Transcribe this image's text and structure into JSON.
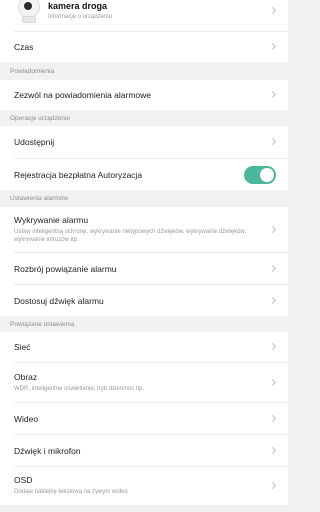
{
  "device": {
    "name": "kamera droga",
    "subtitle": "Informacje o urządzeniu"
  },
  "time_row": {
    "label": "Czas"
  },
  "notifications": {
    "header": "Powiadomienia",
    "allow_alarm_notifications": "Zezwól na powiadomienia alarmowe"
  },
  "device_operations": {
    "header": "Operacje urządzenie",
    "share": "Udostępnij",
    "free_registration": "Rejestracja bezpłatna Autoryzacja",
    "free_registration_enabled": true
  },
  "alarm_settings": {
    "header": "Ustawienia alarmów",
    "detection": {
      "label": "Wykrywanie alarmu",
      "sub": "Ustaw inteligentną ochronę, wykrywanie nietypowych dźwięków, wykrywanie dźwięków, wykrywanie intruzów itp."
    },
    "disarm_linkage": "Rozbrój powiązanie alarmu",
    "custom_sound": "Dostosuj dźwięk alarmu"
  },
  "related_settings": {
    "header": "Powiązane ustawienia",
    "network": "Sieć",
    "image": {
      "label": "Obraz",
      "sub": "WDR, inteligentne oświetlenie, tryb dzień/noc itp."
    },
    "video": "Wideo",
    "sound_mic": "Dźwięk i mikrofon",
    "osd": {
      "label": "OSD",
      "sub": "Dodaje naklejkę tekstową na żywym wideo"
    }
  },
  "colors": {
    "accent": "#4bb89c",
    "background": "#f1f1f3"
  }
}
